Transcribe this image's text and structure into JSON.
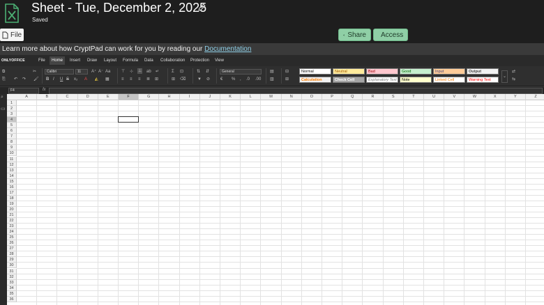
{
  "topbar": {
    "title": "Sheet - Tue, December 2, 2025",
    "status": "Saved",
    "file_label": "File",
    "share_label": "Share",
    "access_label": "Access"
  },
  "banner": {
    "text": "Learn more about how CryptPad can work for you by reading our ",
    "link": "Documentation"
  },
  "menubar": {
    "logo": "ONLYOFFICE",
    "items": [
      "File",
      "Home",
      "Insert",
      "Draw",
      "Layout",
      "Formula",
      "Data",
      "Collaboration",
      "Protection",
      "View"
    ],
    "active": "Home"
  },
  "toolbar": {
    "font_name": "Calibri",
    "font_size": "11",
    "number_format": "General",
    "styles": [
      {
        "label": "Normal",
        "bg": "#ffffff",
        "fg": "#000000"
      },
      {
        "label": "Neutral",
        "bg": "#ffeb9c",
        "fg": "#9c5700"
      },
      {
        "label": "Bad",
        "bg": "#ffc7ce",
        "fg": "#9c0006"
      },
      {
        "label": "Good",
        "bg": "#c6efce",
        "fg": "#006100"
      },
      {
        "label": "Input",
        "bg": "#ffcc99",
        "fg": "#3f3f76"
      },
      {
        "label": "Output",
        "bg": "#f2f2f2",
        "fg": "#3f3f3f"
      },
      {
        "label": "Calculation",
        "bg": "#f2f2f2",
        "fg": "#fa7d00"
      },
      {
        "label": "Check Cell",
        "bg": "#a5a5a5",
        "fg": "#ffffff"
      },
      {
        "label": "Explanatory Text",
        "bg": "#ffffff",
        "fg": "#7f7f7f"
      },
      {
        "label": "Note",
        "bg": "#ffffcc",
        "fg": "#000000"
      },
      {
        "label": "Linked Cell",
        "bg": "#ffffff",
        "fg": "#fa7d00"
      },
      {
        "label": "Warning Text",
        "bg": "#ffffff",
        "fg": "#ff0000"
      }
    ]
  },
  "formula_bar": {
    "cell_ref": "F4",
    "fx": "fx",
    "value": ""
  },
  "sheet": {
    "columns": [
      "A",
      "B",
      "C",
      "D",
      "E",
      "F",
      "G",
      "H",
      "I",
      "J",
      "K",
      "L",
      "M",
      "N",
      "O",
      "P",
      "Q",
      "R",
      "S",
      "T",
      "U",
      "V",
      "W",
      "X",
      "Y",
      "Z"
    ],
    "rows": [
      "1",
      "2",
      "3",
      "4",
      "5",
      "6",
      "7",
      "8",
      "9",
      "10",
      "11",
      "12",
      "13",
      "14",
      "15",
      "16",
      "17",
      "18",
      "19",
      "20",
      "21",
      "22",
      "23",
      "24",
      "25",
      "26",
      "27",
      "28",
      "29",
      "30",
      "31",
      "32",
      "33",
      "34",
      "35",
      "36"
    ],
    "selected_column": "F",
    "selected_row": "4"
  },
  "colors": {
    "accent_green": "#8fcfa6",
    "app_background": "#1e1e1e",
    "link": "#8fd0e8"
  }
}
